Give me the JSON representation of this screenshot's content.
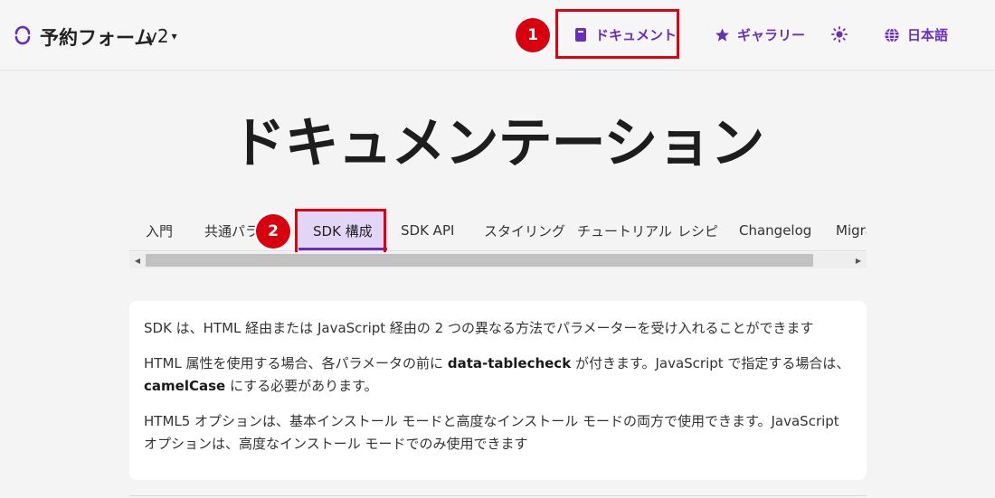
{
  "header": {
    "brand": "予約フォーム",
    "version": "v2",
    "nav": {
      "docs": "ドキュメント",
      "gallery": "ギャラリー",
      "language": "日本語"
    }
  },
  "annotations": {
    "badge1": "1",
    "badge2": "2"
  },
  "page": {
    "title": "ドキュメンテーション"
  },
  "tabs": [
    {
      "label": "入門"
    },
    {
      "label": "共通パラメ"
    },
    {
      "label": "SDK 構成"
    },
    {
      "label": "SDK API"
    },
    {
      "label": "スタイリング"
    },
    {
      "label": "チュートリアル"
    },
    {
      "label": "レシピ"
    },
    {
      "label": "Changelog"
    },
    {
      "label": "Migra"
    }
  ],
  "active_tab": "SDK 構成",
  "content": {
    "p1": "SDK は、HTML 経由または JavaScript 経由の 2 つの異なる方法でパラメーターを受け入れることができます",
    "p2_a": "HTML 属性を使用する場合、各パラメータの前に ",
    "p2_b": "data-tablecheck",
    "p2_c": " が付きます。JavaScript で指定する場合は、",
    "p2_d": "camelCase",
    "p2_e": " にする必要があります。",
    "p3": "HTML5 オプションは、基本インストール モードと高度なインストール モードの両方で使用できます。JavaScript オプションは、高度なインストール モードでのみ使用できます"
  },
  "colors": {
    "accent": "#6a2fb8",
    "active_tab_bg": "#e3d5f5",
    "highlight": "#e0000f"
  },
  "icons": {
    "logo": "loader-logo-icon",
    "docs": "book-icon",
    "gallery": "star-icon",
    "theme": "sun-icon",
    "language": "globe-icon",
    "version": "chevron-down-icon"
  }
}
